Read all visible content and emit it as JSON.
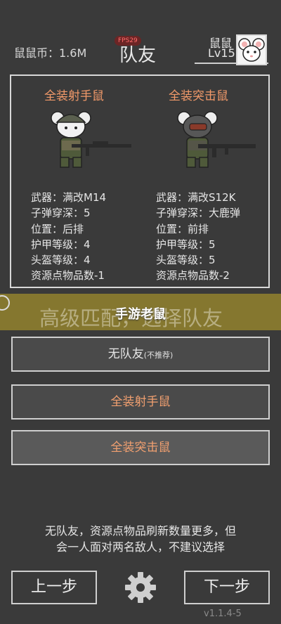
{
  "header": {
    "coins_label": "鼠鼠币：1.6M",
    "fps_badge": "FPS29",
    "title": "队友",
    "user_name": "鼠鼠",
    "user_level": "Lv15"
  },
  "cards": [
    {
      "title": "全装射手鼠",
      "stats": [
        "武器：满改M14",
        "子弹穿深：5",
        "位置：后排",
        "护甲等级：4",
        "头盔等级：4",
        "资源点物品数-1"
      ]
    },
    {
      "title": "全装突击鼠",
      "stats": [
        "武器：满改S12K",
        "子弹穿深：大鹿弹",
        "位置：前排",
        "护甲等级：5",
        "头盔等级：5",
        "资源点物品数-2"
      ]
    }
  ],
  "banner": {
    "underlay_text": "高级匹配，选择队友",
    "overlay_text": "手游老鼠"
  },
  "options": {
    "none_label": "无队友",
    "none_hint": "(不推荐)",
    "sniper_label": "全装射手鼠",
    "assault_label": "全装突击鼠"
  },
  "note": {
    "line1": "无队友，资源点物品刷新数量更多，但",
    "line2": "会一人面对两名敌人，不建议选择"
  },
  "nav": {
    "prev_label": "上一步",
    "next_label": "下一步"
  },
  "version": "v1.1.4-5",
  "colors": {
    "background": "#3a3a3a",
    "accent_orange": "#f39a6a",
    "banner": "#96852d"
  }
}
